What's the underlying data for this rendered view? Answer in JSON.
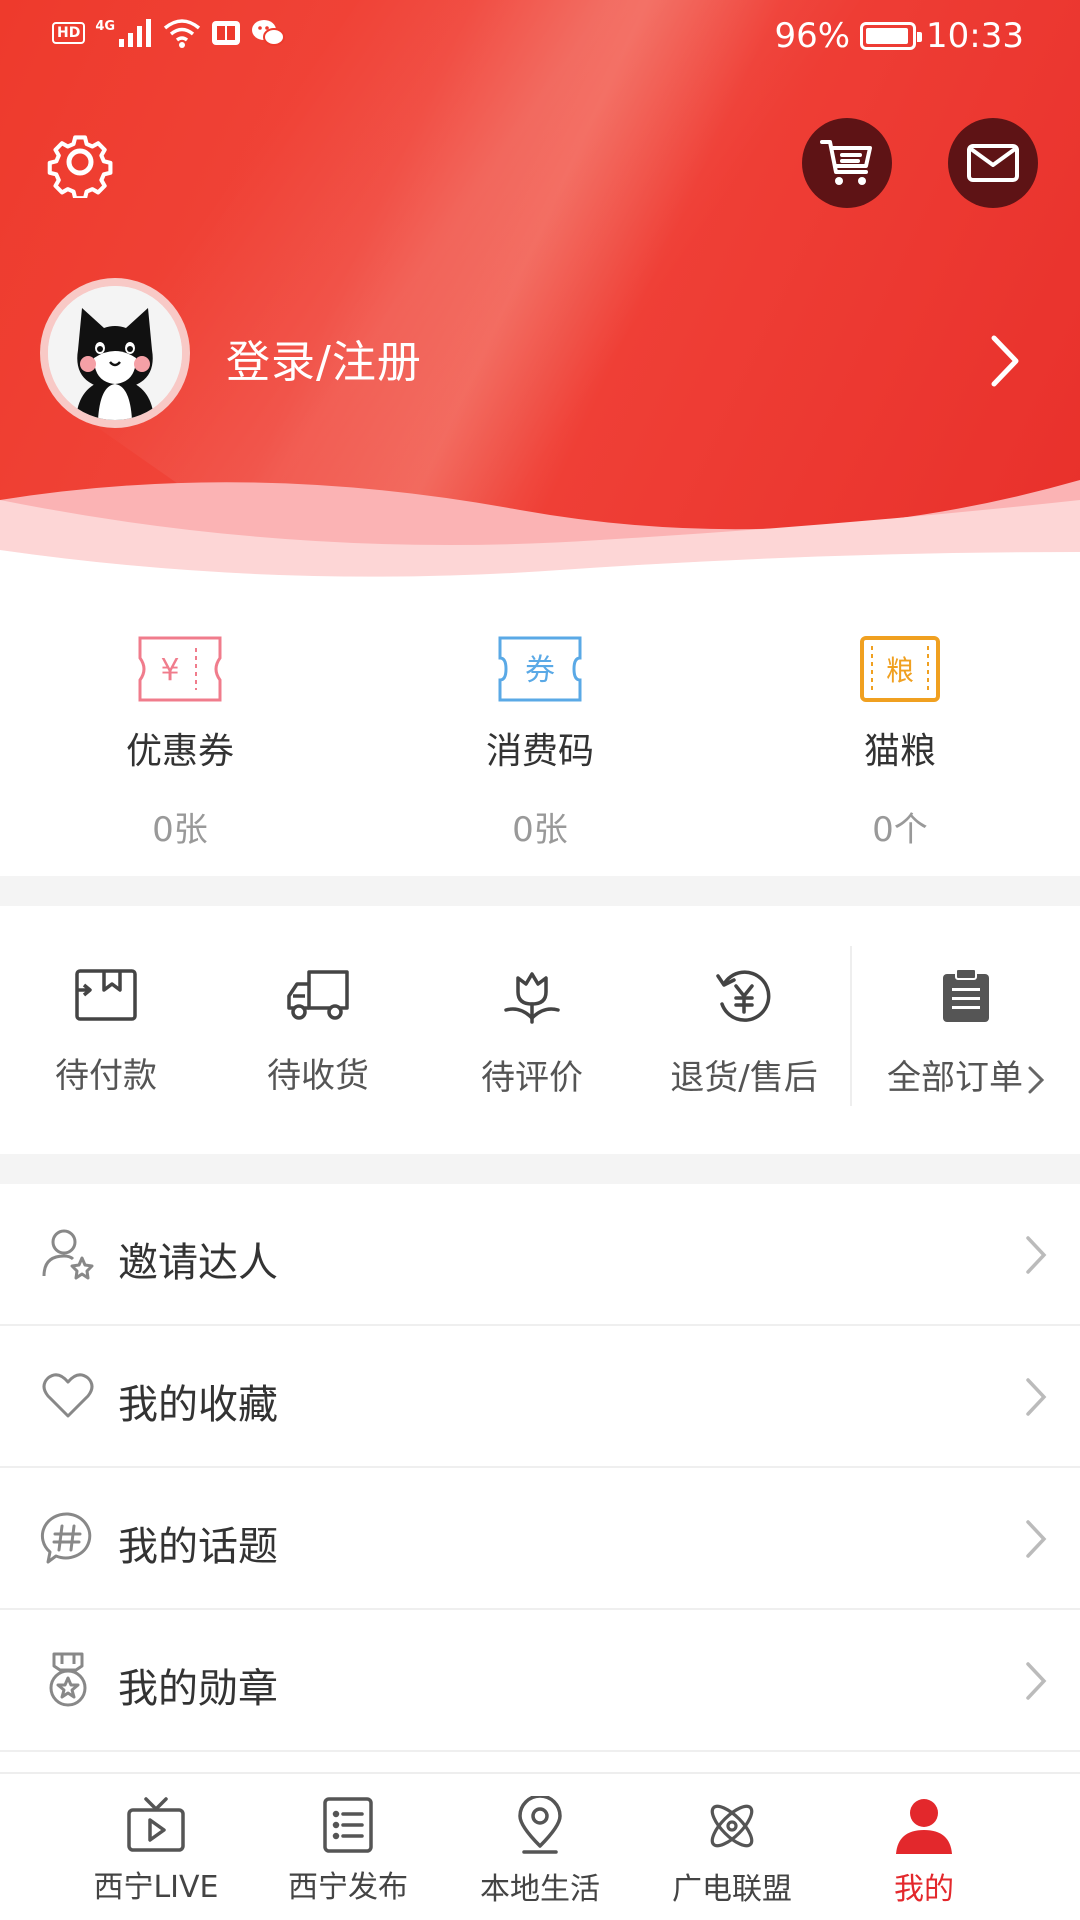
{
  "status_bar": {
    "hd": "HD",
    "network": "4G",
    "battery_text": "96%",
    "battery_level": 0.96,
    "time": "10:33"
  },
  "colors": {
    "brand_red": "#e8302b",
    "dark_button": "#5e1315",
    "active_tab": "#e3282c",
    "coupon_pink": "#f07c8c",
    "code_blue": "#5aa9e6",
    "food_orange": "#f0a020"
  },
  "header": {
    "login_label": "登录/注册"
  },
  "wallet": [
    {
      "icon": "coupon-icon",
      "glyph": "¥",
      "label": "优惠券",
      "count": "0张"
    },
    {
      "icon": "voucher-code-icon",
      "glyph": "券",
      "label": "消费码",
      "count": "0张"
    },
    {
      "icon": "cat-food-icon",
      "glyph": "粮",
      "label": "猫粮",
      "count": "0个"
    }
  ],
  "orders": [
    {
      "icon": "wallet-icon",
      "label": "待付款"
    },
    {
      "icon": "truck-icon",
      "label": "待收货"
    },
    {
      "icon": "flower-icon",
      "label": "待评价"
    },
    {
      "icon": "refund-icon",
      "label": "退货/售后"
    }
  ],
  "orders_all": {
    "icon": "clipboard-icon",
    "label": "全部订单"
  },
  "menu": [
    {
      "icon": "user-star-icon",
      "label": "邀请达人"
    },
    {
      "icon": "heart-icon",
      "label": "我的收藏"
    },
    {
      "icon": "hashtag-icon",
      "label": "我的话题"
    },
    {
      "icon": "medal-icon",
      "label": "我的勋章"
    }
  ],
  "bottom_nav": [
    {
      "icon": "tv-icon",
      "label": "西宁LIVE",
      "active": false
    },
    {
      "icon": "list-icon",
      "label": "西宁发布",
      "active": false
    },
    {
      "icon": "location-pin-icon",
      "label": "本地生活",
      "active": false
    },
    {
      "icon": "atom-icon",
      "label": "广电联盟",
      "active": false
    },
    {
      "icon": "person-icon",
      "label": "我的",
      "active": true
    }
  ]
}
